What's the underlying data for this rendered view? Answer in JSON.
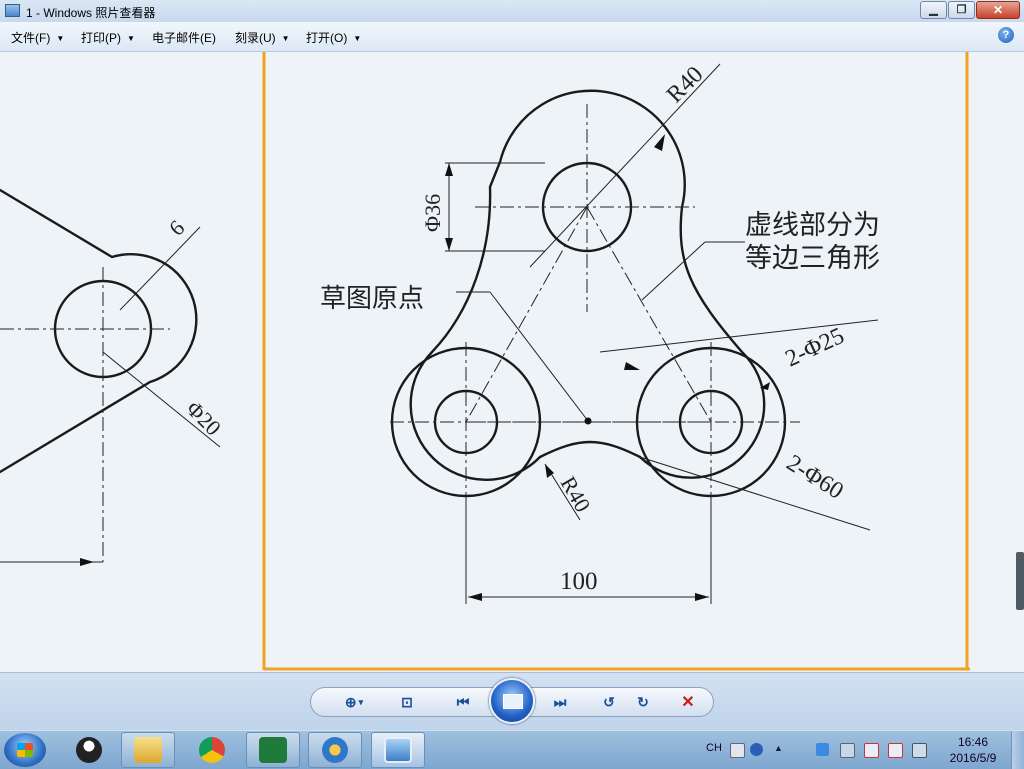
{
  "window": {
    "title": "1 - Windows 照片查看器",
    "minimize": "▁",
    "maximize": "❐",
    "close": "✕"
  },
  "menu": {
    "items": [
      {
        "label": "文件(F)",
        "has_arrow": true
      },
      {
        "label": "打印(P)",
        "has_arrow": true
      },
      {
        "label": "电子邮件(E)",
        "has_arrow": false
      },
      {
        "label": "刻录(U)",
        "has_arrow": true
      },
      {
        "label": "打开(O)",
        "has_arrow": true
      }
    ],
    "help": "?"
  },
  "drawing": {
    "labels": {
      "r40_top": "R40",
      "phi36": "Φ36",
      "dashed_note_1": "虚线部分为",
      "dashed_note_2": "等边三角形",
      "sketch_origin": "草图原点",
      "phi25": "2-Φ25",
      "phi60": "2-Φ60",
      "r40_bottom": "R40",
      "dim100": "100",
      "left_6": "6",
      "left_phi20": "Φ20"
    }
  },
  "controls": {
    "zoom": "⊕",
    "zoom_arrow": "▾",
    "fit": "⊡",
    "previous": "⏮",
    "next": "⏭",
    "rotate_ccw": "↺",
    "rotate_cw": "↻",
    "delete": "✕"
  },
  "taskbar": {
    "tray_lang": "CH",
    "time": "16:46",
    "date": "2016/5/9"
  },
  "colors": {
    "accent": "#1d4f9a",
    "delete": "#cc1a1a",
    "paper": "#eef3f8",
    "frame": "#f4a024"
  }
}
